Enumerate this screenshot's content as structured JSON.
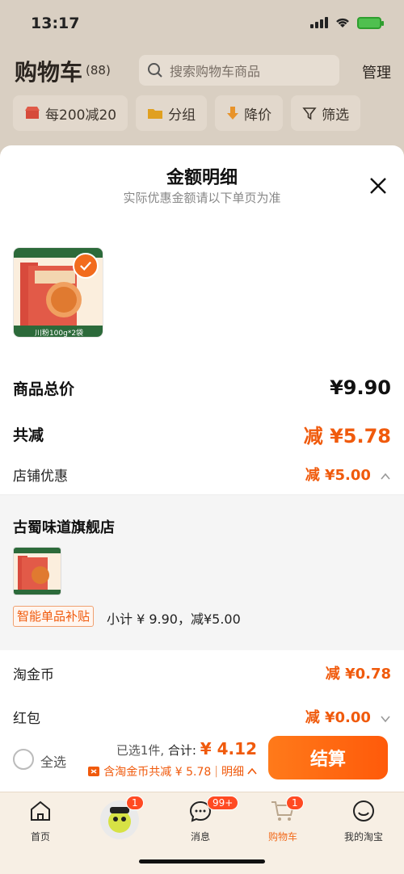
{
  "status": {
    "time": "13:17"
  },
  "header": {
    "title": "购物车",
    "count": "(88)",
    "search_placeholder": "搜索购物车商品",
    "manage": "管理"
  },
  "filters": [
    {
      "label": "每200减20"
    },
    {
      "label": "分组"
    },
    {
      "label": "降价"
    },
    {
      "label": "筛选"
    }
  ],
  "sheet": {
    "title": "金额明细",
    "subtitle": "实际优惠金额请以下单页为准",
    "product_pack_label": "川粉100g*2袋",
    "total_price_label": "商品总价",
    "total_price_value": "¥9.90",
    "total_discount_label": "共减",
    "total_discount_value": "减 ¥5.78",
    "store_discount_label": "店铺优惠",
    "store_discount_value": "减 ¥5.00",
    "store": {
      "name": "古蜀味道旗舰店",
      "subsidy_tag": "智能单品补贴",
      "subtotal": "小计 ¥ 9.90，减¥5.00"
    },
    "coins_label": "淘金币",
    "coins_value": "减 ¥0.78",
    "redpacket_label": "红包",
    "redpacket_value": "减 ¥0.00"
  },
  "bottom_bar": {
    "select_all": "全选",
    "selected_count": "已选1件,",
    "total_label": "合计:",
    "total_value": "¥ 4.12",
    "discount_line": "含淘金币共减 ¥ 5.78",
    "detail_link": "明细",
    "checkout": "结算"
  },
  "tabbar": [
    {
      "label": "首页"
    },
    {
      "label": "",
      "badge": "1"
    },
    {
      "label": "消息",
      "badge": "99+"
    },
    {
      "label": "购物车",
      "badge": "1",
      "active": true
    },
    {
      "label": "我的淘宝"
    }
  ],
  "colors": {
    "accent": "#f05a0c",
    "checkout": "#ff6a12"
  }
}
